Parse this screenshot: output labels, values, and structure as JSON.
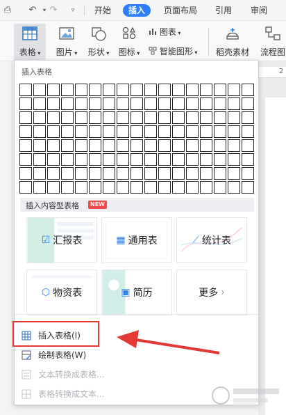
{
  "topbar": {
    "tabs": [
      {
        "label": "开始"
      },
      {
        "label": "插入"
      },
      {
        "label": "页面布局"
      },
      {
        "label": "引用"
      },
      {
        "label": "审阅"
      }
    ]
  },
  "ribbon": {
    "table": "表格",
    "picture": "图片",
    "shape": "形状",
    "icon": "图标",
    "chart": "图表",
    "smart_shape": "智能图形",
    "materials": "稻壳素材",
    "flowchart": "流程图"
  },
  "ruler_mark": "2",
  "dropdown": {
    "title": "插入表格",
    "grid": {
      "columns": 17,
      "rows": 8
    },
    "content_tables_title": "插入内容型表格",
    "new_badge": "NEW",
    "cards": [
      {
        "label": "汇报表",
        "icon": "report-icon"
      },
      {
        "label": "通用表",
        "icon": "grid-icon"
      },
      {
        "label": "统计表",
        "icon": "line-chart-icon"
      },
      {
        "label": "物资表",
        "icon": "box-icon"
      },
      {
        "label": "简历",
        "icon": "id-card-icon"
      },
      {
        "label": "更多",
        "icon": "chevron-right-icon"
      }
    ],
    "menu": [
      {
        "label": "插入表格(I)",
        "enabled": true
      },
      {
        "label": "绘制表格(W)",
        "enabled": true
      },
      {
        "label": "文本转换成表格...",
        "enabled": false
      },
      {
        "label": "表格转换成文本...",
        "enabled": false
      }
    ]
  },
  "colors": {
    "accent": "#2d7ff9",
    "annotation_red": "#e53935"
  }
}
